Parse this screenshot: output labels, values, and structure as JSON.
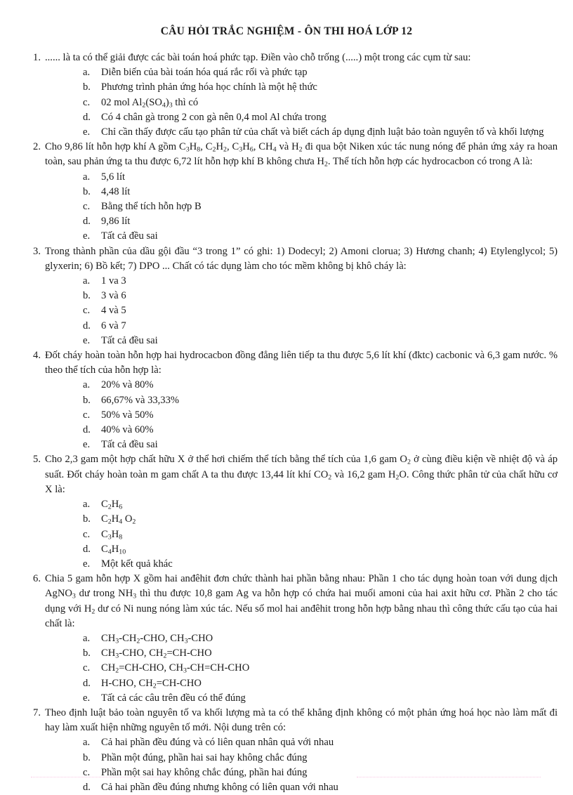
{
  "document": {
    "title": "CÂU HỎI TRẮC NGHIỆM  - ÔN THI HOÁ LỚP 12"
  },
  "questions": [
    {
      "number": "1.",
      "text": "...... là ta có thể giải được các bài toán hoá phức tạp. Điền vào chỗ trống (.....) một trong các cụm từ sau:",
      "options": [
        {
          "letter": "a.",
          "text": "Diễn biến của bài toán hóa quá rắc rối và phức tạp"
        },
        {
          "letter": "b.",
          "text": "Phương trình phản ứng hóa học chính là một hệ thức"
        },
        {
          "letter": "c.",
          "text": "02 mol Al₂(SO₄)₃ thì có",
          "html": "02 mol Al<sub>2</sub>(SO<sub>4</sub>)<sub>3</sub> thì có"
        },
        {
          "letter": "d.",
          "text": "Có 4 chân gà trong 2 con gà nên 0,4 mol Al chứa trong"
        },
        {
          "letter": "e.",
          "text": "Chỉ cần thấy được cấu tạo phân tử của chất và biết cách áp dụng định luật bảo toàn nguyên tố và khối lượng"
        }
      ]
    },
    {
      "number": "2.",
      "text": "Cho 9,86 lít hỗn hợp khí A gồm C₃H₈, C₂H₂, C₃H₆, CH₄ và H₂ đi qua bột Niken xúc tác nung nóng để phản ứng xảy ra hoan toàn, sau phản ứng ta thu được 6,72 lít hỗn hợp khí B không chưa H₂. Thể tích hỗn hợp các hydrocacbon có trong A là:",
      "html": "Cho 9,86 lít hỗn hợp khí A gồm C<sub>3</sub>H<sub>8</sub>, C<sub>2</sub>H<sub>2</sub>, C<sub>3</sub>H<sub>6</sub>, CH<sub>4</sub> và H<sub>2</sub> đi qua bột Niken xúc tác nung nóng để phản ứng xảy ra hoan toàn, sau phản ứng ta thu được 6,72 lít hỗn hợp khí B không chưa H<sub>2</sub>. Thể tích hỗn hợp các hydrocacbon có trong A là:",
      "options": [
        {
          "letter": "a.",
          "text": "5,6 lít"
        },
        {
          "letter": "b.",
          "text": "4,48 lít"
        },
        {
          "letter": "c.",
          "text": "Bằng thể tích hỗn hợp B"
        },
        {
          "letter": "d.",
          "text": "9,86 lít"
        },
        {
          "letter": "e.",
          "text": "Tất cả đều sai"
        }
      ]
    },
    {
      "number": "3.",
      "text": "Trong thành phần của dầu gội đầu “3 trong 1” có ghi: 1) Dodecyl; 2) Amoni clorua; 3) Hương chanh; 4) Etylenglycol;   5) glyxerin;  6) Bồ kết; 7) DPO ... Chất có tác dụng làm cho tóc mềm không bị khô cháy là:",
      "options": [
        {
          "letter": "a.",
          "text": "1 va 3"
        },
        {
          "letter": "b.",
          "text": "3 và 6"
        },
        {
          "letter": "c.",
          "text": "4 và 5"
        },
        {
          "letter": "d.",
          "text": "6 và 7"
        },
        {
          "letter": "e.",
          "text": "Tất cả đều sai"
        }
      ]
    },
    {
      "number": "4.",
      "text": "Đốt cháy hoàn toàn hỗn hợp hai hydrocacbon đồng đẳng liên tiếp ta thu được 5,6 lít khí (đktc) cacbonic và 6,3 gam nước. % theo thể tích của hỗn hợp là:",
      "options": [
        {
          "letter": "a.",
          "text": "20% và 80%"
        },
        {
          "letter": "b.",
          "text": "66,67% và 33,33%"
        },
        {
          "letter": "c.",
          "text": "50% và 50%"
        },
        {
          "letter": "d.",
          "text": "40% và 60%"
        },
        {
          "letter": "e.",
          "text": "Tất cả đều sai"
        }
      ]
    },
    {
      "number": "5.",
      "text": "Cho 2,3 gam một hợp chất hữu X ở thể hơi chiếm thể tích bằng thể tích của 1,6 gam O₂ ở cùng điều kiện về nhiệt độ và áp suất. Đốt cháy hoàn toàn m gam chất A ta thu được 13,44 lít khí CO₂ và 16,2 gam H₂O. Công thức phân tử của chất hữu cơ X là:",
      "html": "Cho 2,3 gam một hợp chất hữu X ở thể hơi chiếm thể tích bằng thể tích của 1,6 gam O<sub>2</sub> ở cùng điều kiện về nhiệt độ và áp suất. Đốt cháy hoàn toàn m gam chất A ta thu được 13,44 lít khí CO<sub>2</sub> và 16,2 gam H<sub>2</sub>O. Công thức phân tử của chất hữu cơ X là:",
      "options": [
        {
          "letter": "a.",
          "text": "C₂H₆",
          "html": "C<sub>2</sub>H<sub>6</sub>"
        },
        {
          "letter": "b.",
          "text": "C₂H₄O₂",
          "html": "C<sub>2</sub>H<sub>4</sub> O<sub>2</sub>"
        },
        {
          "letter": "c.",
          "text": "C₃H₈",
          "html": "C<sub>3</sub>H<sub>8</sub>"
        },
        {
          "letter": "d.",
          "text": "C₄H₁₀",
          "html": "C<sub>4</sub>H<sub>10</sub>"
        },
        {
          "letter": "e.",
          "text": "Một kết quả khác"
        }
      ]
    },
    {
      "number": "6.",
      "text": "Chia 5 gam hỗn hợp X gồm hai anđêhit đơn chức thành hai phần bằng nhau: Phần 1 cho tác dụng hoàn toan với dung dịch AgNO₃ dư trong NH₃ thì thu được 10,8 gam Ag va hỗn hợp có chứa hai muối amoni của hai axit hữu cơ. Phần 2 cho tác dụng với H₂ dư có Ni nung nóng làm xúc tác. Nếu số mol hai anđêhit trong hỗn hợp bằng nhau thì công thức cấu tạo của hai chất là:",
      "html": "Chia 5 gam hỗn hợp X gồm hai anđêhit đơn chức thành hai phần bằng nhau: Phần 1 cho tác dụng hoàn toan với dung dịch AgNO<sub>3</sub> dư trong NH<sub>3</sub> thì thu được 10,8 gam Ag va hỗn hợp có chứa hai muối amoni của hai axit hữu cơ. Phần 2 cho tác dụng với H<sub>2</sub> dư có Ni nung nóng làm xúc tác. Nếu số mol hai anđêhit trong hỗn hợp bằng nhau thì công thức cấu tạo của hai chất là:",
      "options": [
        {
          "letter": "a.",
          "text": "CH₃-CH₂-CHO, CH₃-CHO",
          "html": "CH<sub>3</sub>-CH<sub>2</sub>-CHO, CH<sub>3</sub>-CHO"
        },
        {
          "letter": "b.",
          "text": "CH₃-CHO, CH₂=CH-CHO",
          "html": "CH<sub>3</sub>-CHO, CH<sub>2</sub>=CH-CHO"
        },
        {
          "letter": "c.",
          "text": "CH₂=CH-CHO, CH₃-CH=CH-CHO",
          "html": "CH<sub>2</sub>=CH-CHO, CH<sub>3</sub>-CH=CH-CHO"
        },
        {
          "letter": "d.",
          "text": "H-CHO, CH₂=CH-CHO",
          "html": "H-CHO, CH<sub>2</sub>=CH-CHO"
        },
        {
          "letter": "e.",
          "text": "Tất cả các câu trên đều có thể đúng"
        }
      ]
    },
    {
      "number": "7.",
      "text": "Theo định luật bảo toàn nguyên tố va khối lượng mà ta có thể khẳng định không có một phản ứng hoá học nào làm mất đi hay làm xuất hiện những nguyên tố mới. Nội dung trên có:",
      "options": [
        {
          "letter": "a.",
          "text": "Cả hai phần đều đúng và có liên quan nhân quả với nhau"
        },
        {
          "letter": "b.",
          "text": "Phần một đúng, phần hai sai hay không chắc đúng"
        },
        {
          "letter": "c.",
          "text": "Phần một sai hay không chắc đúng, phần hai đúng"
        },
        {
          "letter": "d.",
          "text": "Cả hai phần đều đúng nhưng không có liên quan với nhau"
        }
      ]
    }
  ],
  "colors": {
    "text": "#1a1a1a",
    "background": "#ffffff",
    "footer_dots": "#f8c8e4"
  }
}
